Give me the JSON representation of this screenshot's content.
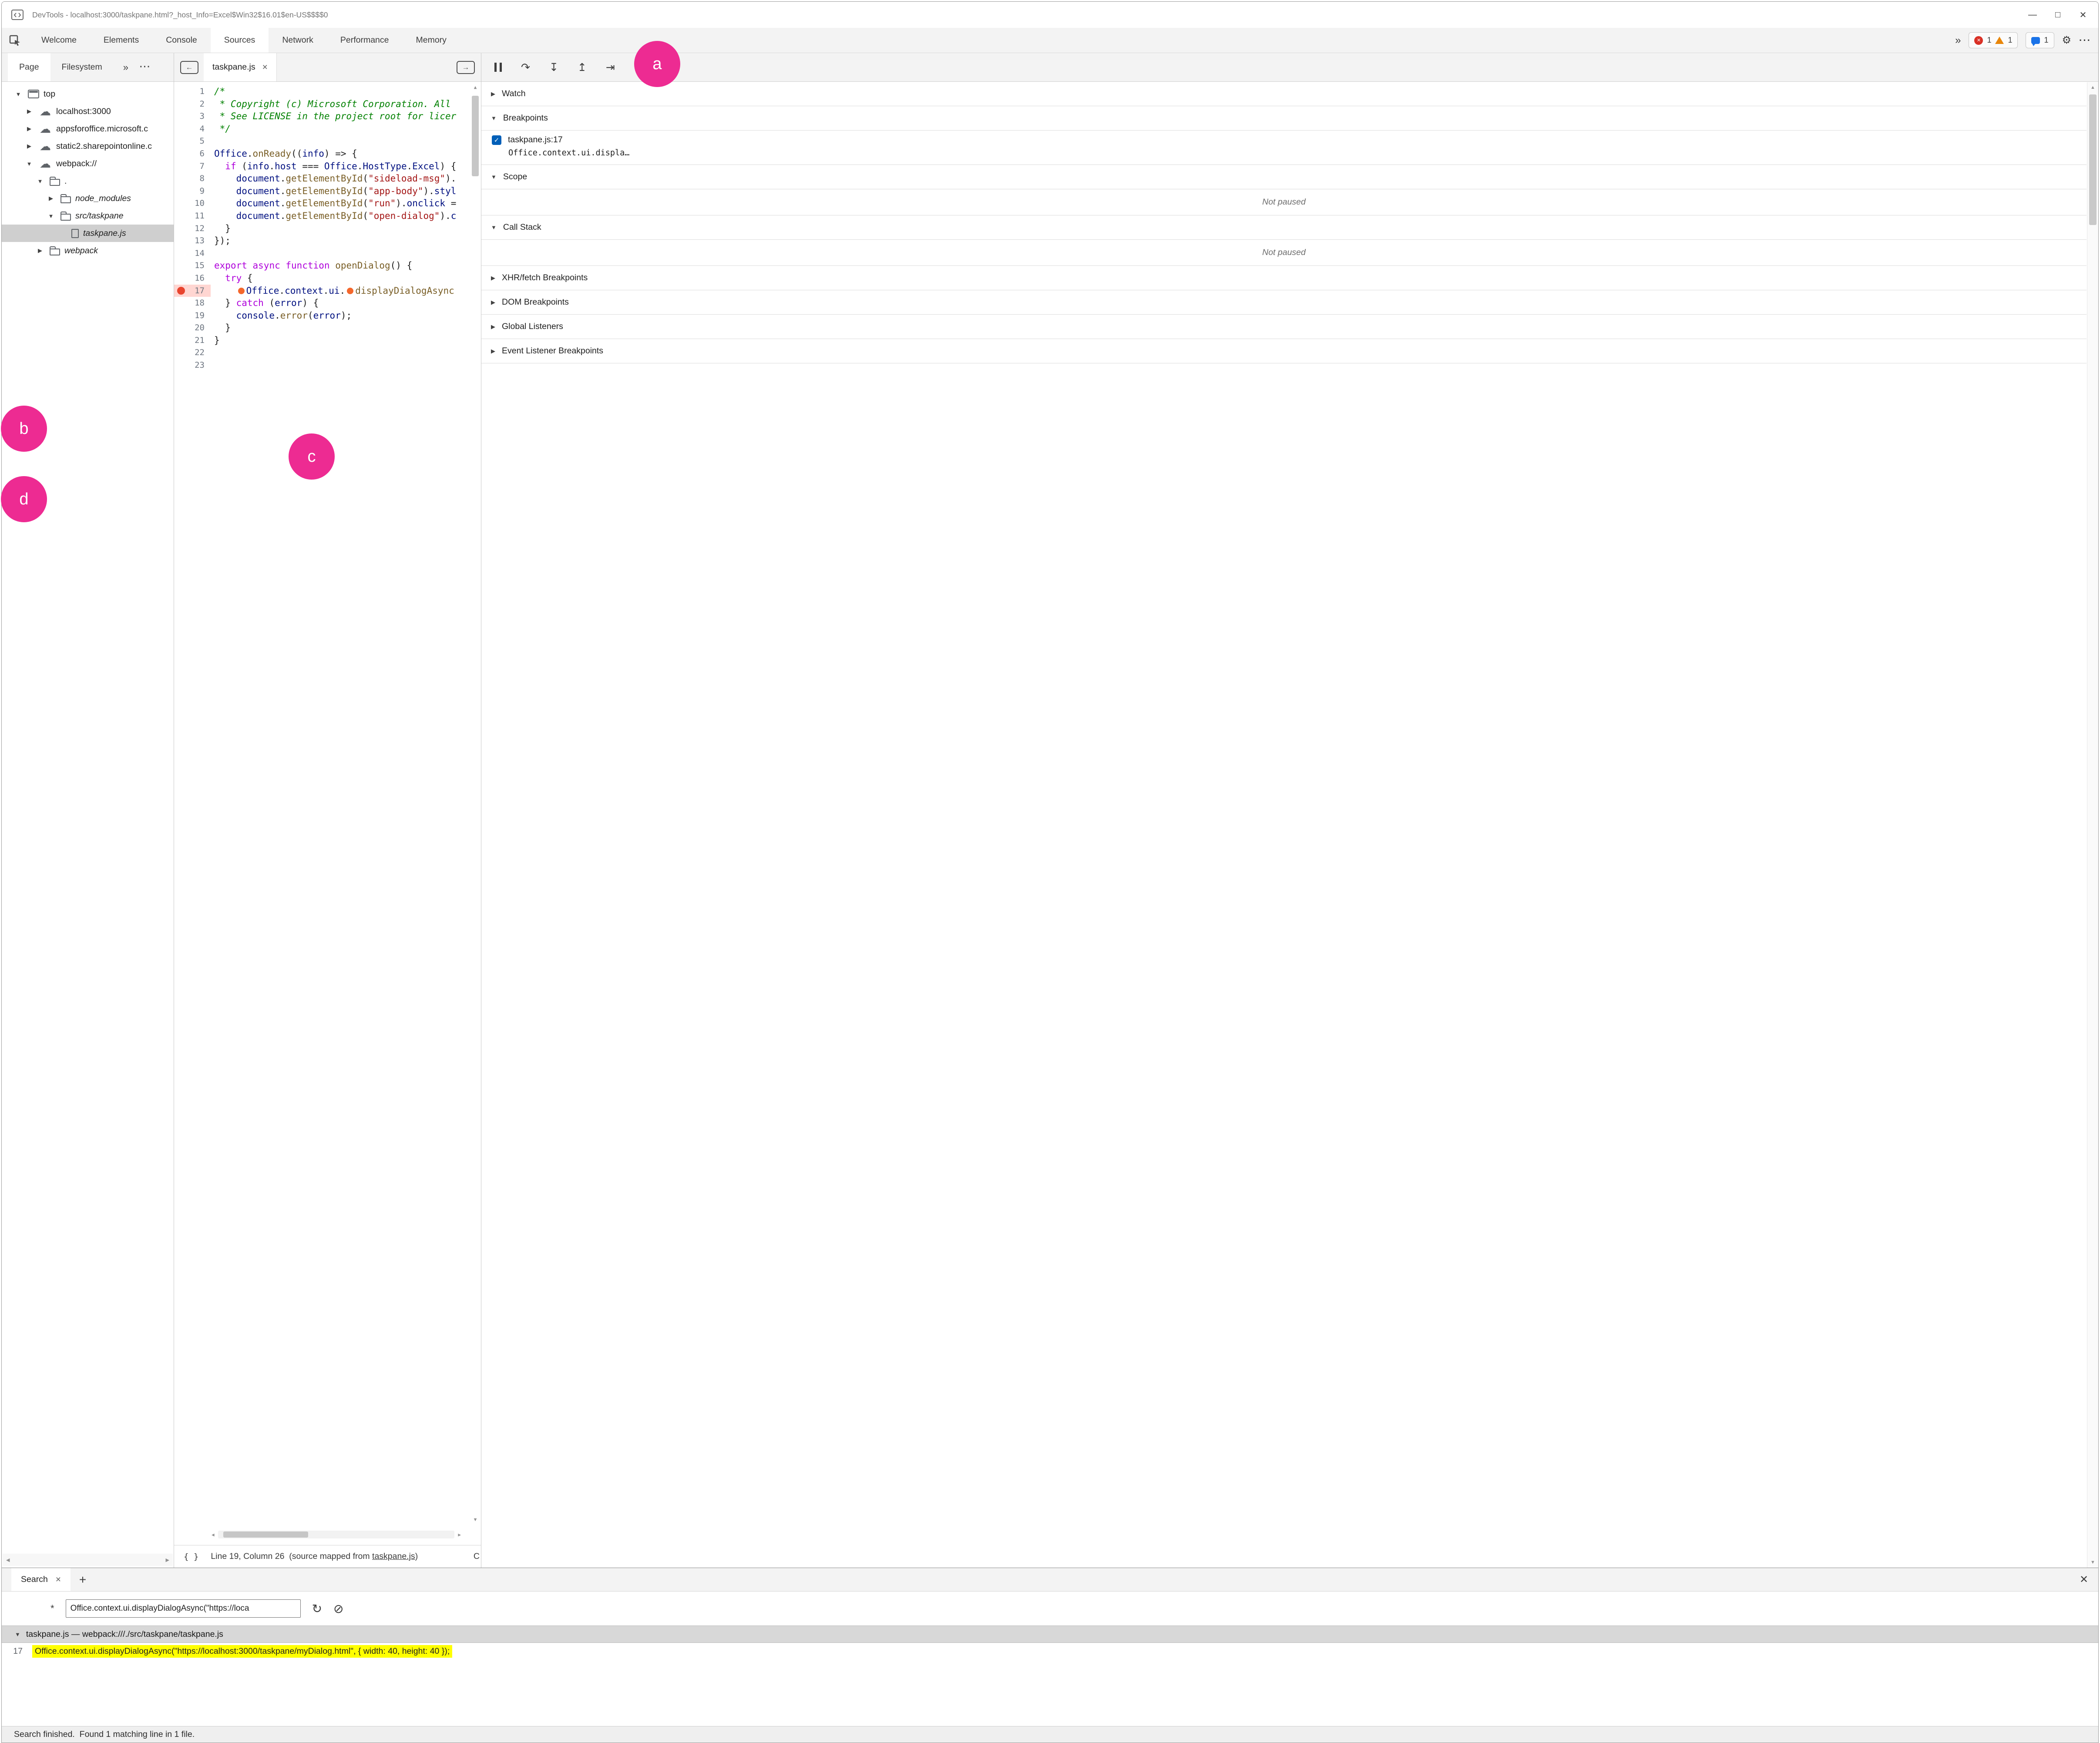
{
  "window": {
    "title": "DevTools - localhost:3000/taskpane.html?_host_Info=Excel$Win32$16.01$en-US$$$$0"
  },
  "glyphs": {
    "minimize": "—",
    "maximize": "□",
    "close": "✕",
    "tab_close": "×",
    "plus": "+",
    "overflow": "»",
    "more": "···",
    "settings": "⚙",
    "error_x": "✕",
    "left_arrow": "←",
    "right_arrow": "→",
    "braces": "{ }",
    "step_over": "↷",
    "step_into": "↧",
    "step_out": "↥",
    "step": "⇥",
    "refresh": "↻",
    "clear": "⊘",
    "star": "*",
    "check": "✓",
    "tri_up": "▲",
    "tri_down": "▼",
    "tri_left": "◀",
    "tri_right": "▶"
  },
  "colors": {
    "callout_pink": "#ED2B92",
    "match_highlight": "#FFFF00",
    "breakpoint_red": "#E8442E",
    "inline_breakpoint_orange": "#F4672C",
    "selected_row_gray": "#CFCFCF",
    "panel_gray": "#F3F3F3"
  },
  "main_toolbar": {
    "tabs": [
      "Welcome",
      "Elements",
      "Console",
      "Sources",
      "Network",
      "Performance",
      "Memory"
    ],
    "active_tab": "Sources",
    "error_count": "1",
    "warning_count": "1",
    "issue_count": "1"
  },
  "navigator": {
    "tabs": [
      {
        "label": "Page",
        "active": true
      },
      {
        "label": "Filesystem",
        "active": false
      }
    ],
    "tree": [
      {
        "label": "top",
        "depth": 0,
        "arrow": "expanded",
        "icon": "frame-icon",
        "italic": false,
        "selected": false
      },
      {
        "label": "localhost:3000",
        "depth": 1,
        "arrow": "collapsed",
        "icon": "cloud-icon",
        "italic": false,
        "selected": false
      },
      {
        "label": "appsforoffice.microsoft.c",
        "depth": 1,
        "arrow": "collapsed",
        "icon": "cloud-icon",
        "italic": false,
        "selected": false
      },
      {
        "label": "static2.sharepointonline.c",
        "depth": 1,
        "arrow": "collapsed",
        "icon": "cloud-icon",
        "italic": false,
        "selected": false
      },
      {
        "label": "webpack://",
        "depth": 1,
        "arrow": "expanded",
        "icon": "cloud-icon",
        "italic": false,
        "selected": false
      },
      {
        "label": ".",
        "depth": 2,
        "arrow": "expanded",
        "icon": "folder-icon",
        "italic": false,
        "selected": false
      },
      {
        "label": "node_modules",
        "depth": 3,
        "arrow": "collapsed",
        "icon": "folder-icon",
        "italic": true,
        "selected": false
      },
      {
        "label": "src/taskpane",
        "depth": 3,
        "arrow": "expanded",
        "icon": "folder-icon",
        "italic": true,
        "selected": false
      },
      {
        "label": "taskpane.js",
        "depth": 4,
        "arrow": "none",
        "icon": "file-icon",
        "italic": true,
        "selected": true
      },
      {
        "label": "webpack",
        "depth": 2,
        "arrow": "collapsed",
        "icon": "folder-icon",
        "italic": true,
        "selected": false
      }
    ]
  },
  "editor": {
    "tab_label": "taskpane.js",
    "status_prefix": "Line 19, Column 26  (source mapped from ",
    "status_link": "taskpane.js",
    "status_suffix": ")",
    "status_overflow": "C",
    "lines": [
      {
        "n": 1,
        "tokens": [
          {
            "t": "/*",
            "c": "com"
          }
        ]
      },
      {
        "n": 2,
        "tokens": [
          {
            "t": " * Copyright (c) Microsoft Corporation. All",
            "c": "com"
          }
        ]
      },
      {
        "n": 3,
        "tokens": [
          {
            "t": " * See LICENSE in the project root for licer",
            "c": "com"
          }
        ]
      },
      {
        "n": 4,
        "tokens": [
          {
            "t": " */",
            "c": "com"
          }
        ]
      },
      {
        "n": 5,
        "tokens": []
      },
      {
        "n": 6,
        "tokens": [
          {
            "t": "Office",
            "c": "id"
          },
          {
            "t": ".",
            "c": "pl"
          },
          {
            "t": "onReady",
            "c": "fn"
          },
          {
            "t": "((",
            "c": "pl"
          },
          {
            "t": "info",
            "c": "id"
          },
          {
            "t": ") => {",
            "c": "pl"
          }
        ]
      },
      {
        "n": 7,
        "tokens": [
          {
            "t": "  ",
            "c": "pl"
          },
          {
            "t": "if",
            "c": "kw"
          },
          {
            "t": " (",
            "c": "pl"
          },
          {
            "t": "info",
            "c": "id"
          },
          {
            "t": ".",
            "c": "pl"
          },
          {
            "t": "host",
            "c": "id"
          },
          {
            "t": " === ",
            "c": "pl"
          },
          {
            "t": "Office",
            "c": "id"
          },
          {
            "t": ".",
            "c": "pl"
          },
          {
            "t": "HostType",
            "c": "id"
          },
          {
            "t": ".",
            "c": "pl"
          },
          {
            "t": "Excel",
            "c": "id"
          },
          {
            "t": ") {",
            "c": "pl"
          }
        ]
      },
      {
        "n": 8,
        "tokens": [
          {
            "t": "    ",
            "c": "pl"
          },
          {
            "t": "document",
            "c": "id"
          },
          {
            "t": ".",
            "c": "pl"
          },
          {
            "t": "getElementById",
            "c": "fn"
          },
          {
            "t": "(",
            "c": "pl"
          },
          {
            "t": "\"sideload-msg\"",
            "c": "str"
          },
          {
            "t": ").",
            "c": "pl"
          }
        ]
      },
      {
        "n": 9,
        "tokens": [
          {
            "t": "    ",
            "c": "pl"
          },
          {
            "t": "document",
            "c": "id"
          },
          {
            "t": ".",
            "c": "pl"
          },
          {
            "t": "getElementById",
            "c": "fn"
          },
          {
            "t": "(",
            "c": "pl"
          },
          {
            "t": "\"app-body\"",
            "c": "str"
          },
          {
            "t": ").",
            "c": "pl"
          },
          {
            "t": "styl",
            "c": "id"
          }
        ]
      },
      {
        "n": 10,
        "tokens": [
          {
            "t": "    ",
            "c": "pl"
          },
          {
            "t": "document",
            "c": "id"
          },
          {
            "t": ".",
            "c": "pl"
          },
          {
            "t": "getElementById",
            "c": "fn"
          },
          {
            "t": "(",
            "c": "pl"
          },
          {
            "t": "\"run\"",
            "c": "str"
          },
          {
            "t": ").",
            "c": "pl"
          },
          {
            "t": "onclick",
            "c": "id"
          },
          {
            "t": " =",
            "c": "pl"
          }
        ]
      },
      {
        "n": 11,
        "tokens": [
          {
            "t": "    ",
            "c": "pl"
          },
          {
            "t": "document",
            "c": "id"
          },
          {
            "t": ".",
            "c": "pl"
          },
          {
            "t": "getElementById",
            "c": "fn"
          },
          {
            "t": "(",
            "c": "pl"
          },
          {
            "t": "\"open-dialog\"",
            "c": "str"
          },
          {
            "t": ").",
            "c": "pl"
          },
          {
            "t": "c",
            "c": "id"
          }
        ]
      },
      {
        "n": 12,
        "tokens": [
          {
            "t": "  }",
            "c": "pl"
          }
        ]
      },
      {
        "n": 13,
        "tokens": [
          {
            "t": "});",
            "c": "pl"
          }
        ]
      },
      {
        "n": 14,
        "tokens": []
      },
      {
        "n": 15,
        "tokens": [
          {
            "t": "export",
            "c": "kw"
          },
          {
            "t": " ",
            "c": "pl"
          },
          {
            "t": "async",
            "c": "kw"
          },
          {
            "t": " ",
            "c": "pl"
          },
          {
            "t": "function",
            "c": "kw"
          },
          {
            "t": " ",
            "c": "pl"
          },
          {
            "t": "openDialog",
            "c": "fn"
          },
          {
            "t": "() {",
            "c": "pl"
          }
        ]
      },
      {
        "n": 16,
        "tokens": [
          {
            "t": "  ",
            "c": "pl"
          },
          {
            "t": "try",
            "c": "kw"
          },
          {
            "t": " {",
            "c": "pl"
          }
        ]
      },
      {
        "n": 17,
        "breakpoint": true,
        "tokens": [
          {
            "t": "    ",
            "c": "pl"
          },
          {
            "c": "dot"
          },
          {
            "t": "Office",
            "c": "id"
          },
          {
            "t": ".",
            "c": "pl"
          },
          {
            "t": "context",
            "c": "id"
          },
          {
            "t": ".",
            "c": "pl"
          },
          {
            "t": "ui",
            "c": "id"
          },
          {
            "t": ".",
            "c": "pl"
          },
          {
            "c": "dot"
          },
          {
            "t": "displayDialogAsync",
            "c": "fn"
          }
        ]
      },
      {
        "n": 18,
        "tokens": [
          {
            "t": "  } ",
            "c": "pl"
          },
          {
            "t": "catch",
            "c": "kw"
          },
          {
            "t": " (",
            "c": "pl"
          },
          {
            "t": "error",
            "c": "id"
          },
          {
            "t": ") {",
            "c": "pl"
          }
        ]
      },
      {
        "n": 19,
        "tokens": [
          {
            "t": "    ",
            "c": "pl"
          },
          {
            "t": "console",
            "c": "id"
          },
          {
            "t": ".",
            "c": "pl"
          },
          {
            "t": "error",
            "c": "fn"
          },
          {
            "t": "(",
            "c": "pl"
          },
          {
            "t": "error",
            "c": "id"
          },
          {
            "t": ");",
            "c": "pl"
          }
        ]
      },
      {
        "n": 20,
        "tokens": [
          {
            "t": "  }",
            "c": "pl"
          }
        ]
      },
      {
        "n": 21,
        "tokens": [
          {
            "t": "}",
            "c": "pl"
          }
        ]
      },
      {
        "n": 22,
        "tokens": []
      },
      {
        "n": 23,
        "tokens": []
      }
    ]
  },
  "debugger": {
    "sections": [
      {
        "label": "Watch",
        "state": "collapsed"
      },
      {
        "label": "Breakpoints",
        "state": "expanded",
        "entry": {
          "checked": true,
          "location": "taskpane.js:17",
          "code": "Office.context.ui.displa…"
        }
      },
      {
        "label": "Scope",
        "state": "expanded",
        "message": "Not paused"
      },
      {
        "label": "Call Stack",
        "state": "expanded",
        "message": "Not paused"
      },
      {
        "label": "XHR/fetch Breakpoints",
        "state": "collapsed"
      },
      {
        "label": "DOM Breakpoints",
        "state": "collapsed"
      },
      {
        "label": "Global Listeners",
        "state": "collapsed"
      },
      {
        "label": "Event Listener Breakpoints",
        "state": "collapsed"
      }
    ]
  },
  "search": {
    "tab_label": "Search",
    "query": "Office.context.ui.displayDialogAsync(\"https://loca",
    "file_header": "taskpane.js — webpack:///./src/taskpane/taskpane.js",
    "result": {
      "line": "17",
      "text": "Office.context.ui.displayDialogAsync(\"https://localhost:3000/taskpane/myDialog.html\", { width: 40, height: 40 });"
    },
    "status": "Search finished.  Found 1 matching line in 1 file."
  },
  "callouts": [
    {
      "label": "a"
    },
    {
      "label": "b"
    },
    {
      "label": "c"
    },
    {
      "label": "d"
    }
  ]
}
